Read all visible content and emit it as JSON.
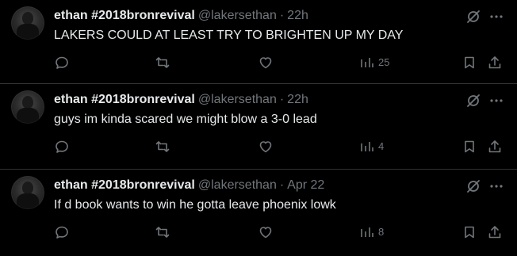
{
  "colors": {
    "background": "#000000",
    "text_primary": "#e7e9ea",
    "text_secondary": "#71767b",
    "divider": "#2f3336"
  },
  "icons": {
    "corner": [
      "grok-icon",
      "more-icon"
    ],
    "actions": [
      "reply-icon",
      "repost-icon",
      "like-icon",
      "views-icon",
      "bookmark-icon",
      "share-icon"
    ]
  },
  "tweets": [
    {
      "display_name": "ethan #2018bronrevival",
      "handle": "@lakersethan",
      "separator": "·",
      "time": "22h",
      "text": "LAKERS COULD AT LEAST TRY TO BRIGHTEN UP MY DAY",
      "views": "25"
    },
    {
      "display_name": "ethan #2018bronrevival",
      "handle": "@lakersethan",
      "separator": "·",
      "time": "22h",
      "text": "guys im kinda scared we might blow a 3-0 lead",
      "views": "4"
    },
    {
      "display_name": "ethan #2018bronrevival",
      "handle": "@lakersethan",
      "separator": "·",
      "time": "Apr 22",
      "text": "If d book wants to win he gotta leave phoenix lowk",
      "views": "8"
    }
  ]
}
